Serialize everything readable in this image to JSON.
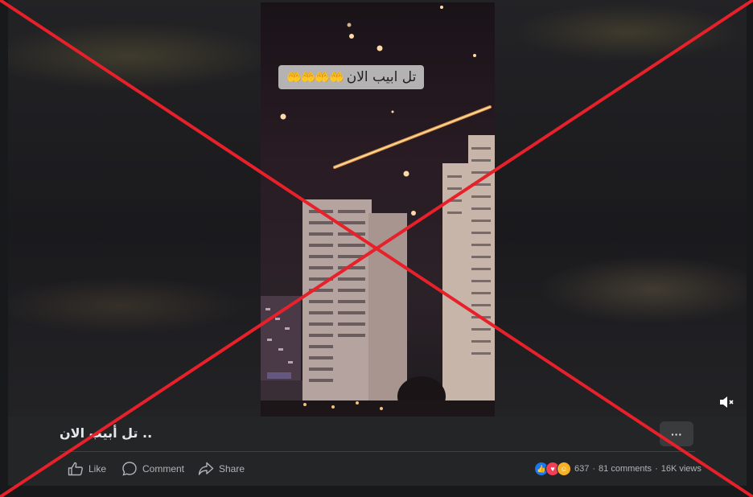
{
  "video": {
    "overlay_caption": "تل ابيب الان",
    "overlay_emoji": "🤲🤲🤲🤲",
    "mute_icon": "volume-muted-icon"
  },
  "post": {
    "title": "تل أبيب الان ..",
    "more_label": "···"
  },
  "actions": {
    "like_label": "Like",
    "comment_label": "Comment",
    "share_label": "Share"
  },
  "stats": {
    "reactions": [
      "like",
      "love",
      "care"
    ],
    "reaction_count": "637",
    "separator": "·",
    "comments": "81 comments",
    "views": "16K views"
  },
  "colors": {
    "background": "#18191a",
    "card": "#242526",
    "text_secondary": "#b0b3b8",
    "cross": "#e8202a"
  }
}
